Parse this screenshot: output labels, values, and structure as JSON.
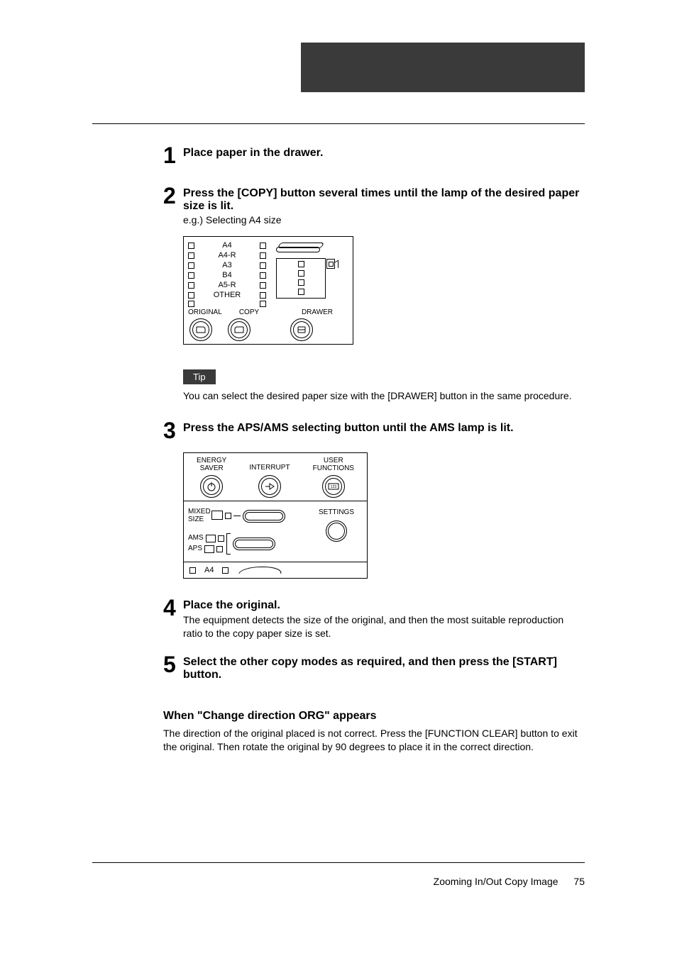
{
  "steps": {
    "s1": {
      "num": "1",
      "title": "Place paper in the drawer."
    },
    "s2": {
      "num": "2",
      "title": "Press the [COPY] button several times until the lamp of the desired paper size is lit.",
      "sub": "e.g.) Selecting A4 size"
    },
    "s3": {
      "num": "3",
      "title": "Press the APS/AMS selecting button until the AMS lamp is lit."
    },
    "s4": {
      "num": "4",
      "title": "Place the original.",
      "desc": "The equipment detects the size of the original, and then the most suitable reproduction ratio to the copy paper size is set."
    },
    "s5": {
      "num": "5",
      "title": "Select the other copy modes as required, and then press the [START] button."
    }
  },
  "tip": {
    "label": "Tip",
    "text": "You can select the desired paper size with the [DRAWER] button in the same procedure."
  },
  "subheading": {
    "title": "When \"Change direction ORG\" appears",
    "body": "The direction of the original placed is not correct. Press the [FUNCTION CLEAR] button to exit the original. Then rotate the original by 90 degrees to place it in the correct direction."
  },
  "panel1": {
    "sizes": [
      "A4",
      "A4-R",
      "A3",
      "B4",
      "A5-R",
      "OTHER"
    ],
    "labels": {
      "original": "ORIGINAL",
      "copy": "COPY",
      "drawer": "DRAWER"
    }
  },
  "panel2": {
    "top": {
      "energy": "ENERGY\nSAVER",
      "interrupt": "INTERRUPT",
      "user": "USER\nFUNCTIONS"
    },
    "left": {
      "mixed": "MIXED\nSIZE",
      "ams": "AMS",
      "aps": "APS"
    },
    "right": {
      "settings": "SETTINGS"
    },
    "bottom": {
      "size": "A4"
    }
  },
  "footer": {
    "text": "Zooming In/Out Copy Image",
    "page": "75"
  }
}
